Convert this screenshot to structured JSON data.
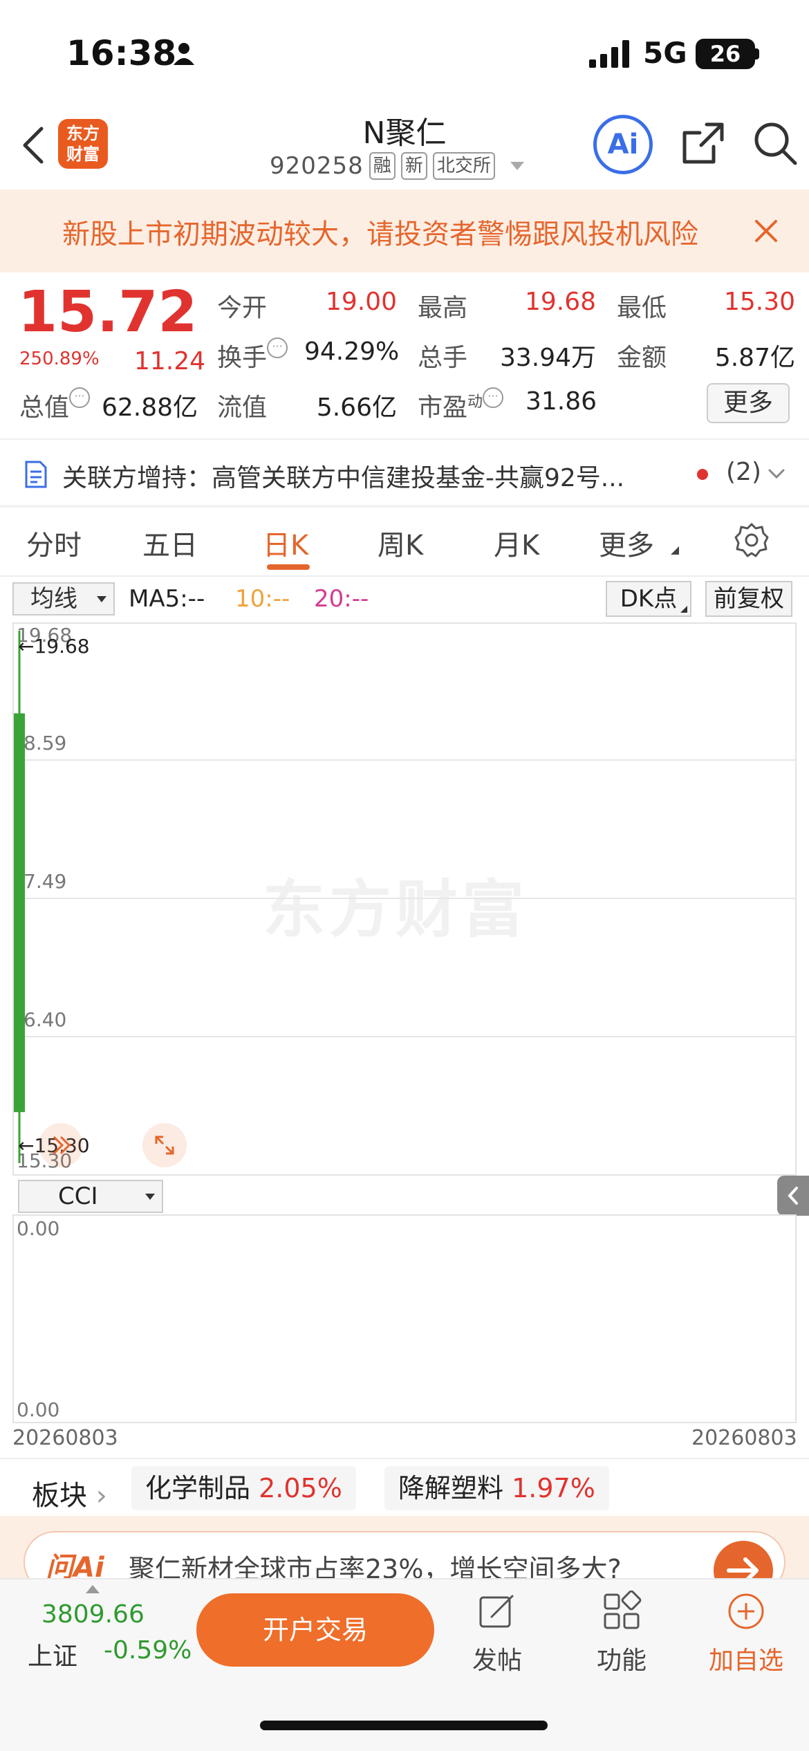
{
  "status_bar": {
    "time": "16:38",
    "network": "5G",
    "battery": "26"
  },
  "header": {
    "logo_line1": "东方",
    "logo_line2": "财富",
    "stock_name": "N聚仁",
    "stock_code": "920258",
    "tags": [
      "融",
      "新",
      "北交所"
    ],
    "ai_label": "Ai"
  },
  "warning": {
    "text": "新股上市初期波动较大，请投资者警惕跟风投机风险"
  },
  "quote": {
    "price": "15.72",
    "change_pct": "250.89%",
    "change": "11.24",
    "fields": {
      "open_label": "今开",
      "open": "19.00",
      "high_label": "最高",
      "high": "19.68",
      "low_label": "最低",
      "low": "15.30",
      "turnover_label": "换手",
      "turnover": "94.29%",
      "volume_label": "总手",
      "volume": "33.94万",
      "amount_label": "金额",
      "amount": "5.87亿",
      "total_mv_label": "总值",
      "total_mv": "62.88亿",
      "float_mv_label": "流值",
      "float_mv": "5.66亿",
      "pe_label": "市盈",
      "pe_sup": "动",
      "pe": "31.86"
    },
    "more_label": "更多"
  },
  "related": {
    "text": "关联方增持：高管关联方中信建投基金-共赢92号...",
    "count": "(2)"
  },
  "tabs": [
    {
      "label": "分时",
      "active": false
    },
    {
      "label": "五日",
      "active": false
    },
    {
      "label": "日K",
      "active": true
    },
    {
      "label": "周K",
      "active": false
    },
    {
      "label": "月K",
      "active": false
    },
    {
      "label": "更多",
      "active": false
    }
  ],
  "toolbar": {
    "ma_select": "均线",
    "ma5": "MA5:--",
    "ma10": "10:--",
    "ma20": "20:--",
    "dk_label": "DK点",
    "fq_label": "前复权"
  },
  "chart": {
    "watermark": "东方财富",
    "y_labels": [
      "19.68",
      "8.59",
      "7.49",
      "6.40",
      "15.30"
    ],
    "high_marker": "←19.68",
    "low_marker": "←15.30",
    "colors": {
      "down": "#3aa335",
      "up": "#e0332f"
    }
  },
  "chart_data": {
    "type": "candlestick",
    "x": [
      "20260803"
    ],
    "open": [
      19.0
    ],
    "high": [
      19.68
    ],
    "low": [
      15.3
    ],
    "close": [
      15.72
    ],
    "ylim": [
      15.3,
      19.68
    ]
  },
  "indicator": {
    "select": "CCI",
    "top_value": "0.00",
    "bottom_value": "0.00",
    "date_left": "20260803",
    "date_right": "20260803"
  },
  "sectors": {
    "label": "板块",
    "items": [
      {
        "name": "化学制品",
        "pct": "2.05%"
      },
      {
        "name": "降解塑料",
        "pct": "1.97%"
      }
    ]
  },
  "ai_banner": {
    "logo": "问Ai",
    "text": "聚仁新材全球市占率23%，增长空间多大?"
  },
  "bottom": {
    "index_value": "3809.66",
    "index_name": "上证",
    "index_change": "-0.59%",
    "trade_label": "开户交易",
    "nav": [
      {
        "label": "发帖",
        "icon": "edit-icon"
      },
      {
        "label": "功能",
        "icon": "grid-icon"
      },
      {
        "label": "加自选",
        "icon": "plus-circle-icon"
      }
    ]
  }
}
